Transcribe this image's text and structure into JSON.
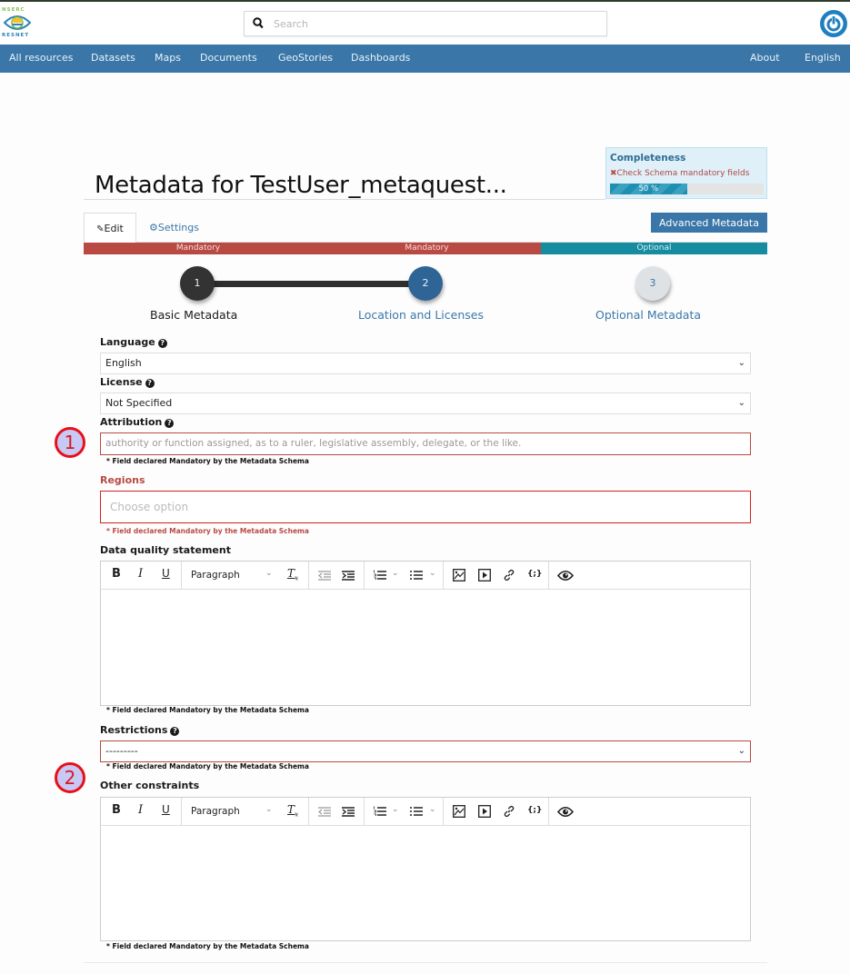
{
  "header": {
    "logo": {
      "top_text": "NSERC",
      "bottom_text": "RESNET",
      "icon": "eye-globe-logo-icon"
    },
    "search": {
      "placeholder": "Search",
      "value": "",
      "icon": "search-icon"
    },
    "power_icon": "power-icon"
  },
  "nav": {
    "left": [
      "All resources",
      "Datasets",
      "Maps",
      "Documents",
      "GeoStories",
      "Dashboards"
    ],
    "right": [
      "About",
      "English"
    ]
  },
  "page": {
    "title": "Metadata for TestUser_metaquest..."
  },
  "completeness": {
    "title": "Completeness",
    "warning": "Check Schema mandatory fields",
    "warning_icon": "x-icon",
    "progress_percent": 50,
    "progress_label": "50 %"
  },
  "tabs": {
    "edit": {
      "label": "Edit",
      "icon": "pencil-icon"
    },
    "settings": {
      "label": "Settings",
      "icon": "gear-icon"
    }
  },
  "advanced_button": "Advanced Metadata",
  "step_bars": [
    "Mandatory",
    "Mandatory",
    "Optional"
  ],
  "steps": [
    {
      "number": "1",
      "label": "Basic Metadata",
      "state": "done"
    },
    {
      "number": "2",
      "label": "Location and Licenses",
      "state": "current"
    },
    {
      "number": "3",
      "label": "Optional Metadata",
      "state": "pending"
    }
  ],
  "form": {
    "language": {
      "label": "Language",
      "value": "English"
    },
    "license": {
      "label": "License",
      "value": "Not Specified"
    },
    "attribution": {
      "label": "Attribution",
      "placeholder": "authority or function assigned, as to a ruler, legislative assembly, delegate, or the like.",
      "note": "* Field declared Mandatory by the Metadata Schema"
    },
    "regions": {
      "label": "Regions",
      "placeholder": "Choose option",
      "note": "* Field declared Mandatory by the Metadata Schema"
    },
    "data_quality": {
      "label": "Data quality statement",
      "note": "* Field declared Mandatory by the Metadata Schema"
    },
    "restrictions": {
      "label": "Restrictions",
      "value": "---------",
      "note": "* Field declared Mandatory by the Metadata Schema"
    },
    "other_constraints": {
      "label": "Other constraints",
      "note": "* Field declared Mandatory by the Metadata Schema"
    }
  },
  "editor_toolbar": {
    "bold": "B",
    "italic": "I",
    "underline": "U",
    "block_format": "Paragraph",
    "clear_format": "Tx",
    "icons": [
      "outdent-icon",
      "indent-icon",
      "numbered-list-icon",
      "bullet-list-icon",
      "image-icon",
      "media-icon",
      "link-icon",
      "code-sample-icon",
      "preview-eye-icon"
    ]
  },
  "annotations": [
    "1",
    "2"
  ],
  "colors": {
    "nav_blue": "#3a77a8",
    "mandatory_red": "#b94a43",
    "optional_teal": "#168ca0",
    "step_done": "#333333",
    "step_current": "#2e6496"
  }
}
